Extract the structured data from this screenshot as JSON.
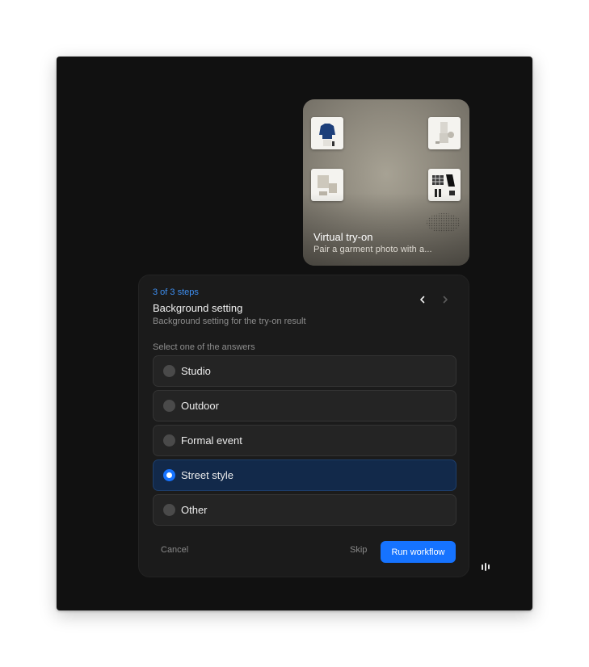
{
  "preview": {
    "title": "Virtual try-on",
    "subtitle": "Pair a garment photo with a..."
  },
  "step": {
    "counter": "3 of 3 steps",
    "title": "Background setting",
    "description": "Background setting for the try-on result",
    "prompt": "Select one of the answers",
    "options": [
      {
        "label": "Studio",
        "selected": false
      },
      {
        "label": "Outdoor",
        "selected": false
      },
      {
        "label": "Formal event",
        "selected": false
      },
      {
        "label": "Street style",
        "selected": true
      },
      {
        "label": "Other",
        "selected": false
      }
    ]
  },
  "footer": {
    "cancel_label": "Cancel",
    "skip_label": "Skip",
    "run_label": "Run workflow"
  },
  "icons": {
    "prev": "chevron-left-icon",
    "next": "chevron-right-icon",
    "brand": "brand-logo-icon"
  },
  "colors": {
    "accent": "#1673ff",
    "step_counter": "#3d8ef0",
    "selected_bg": "#12294a"
  }
}
